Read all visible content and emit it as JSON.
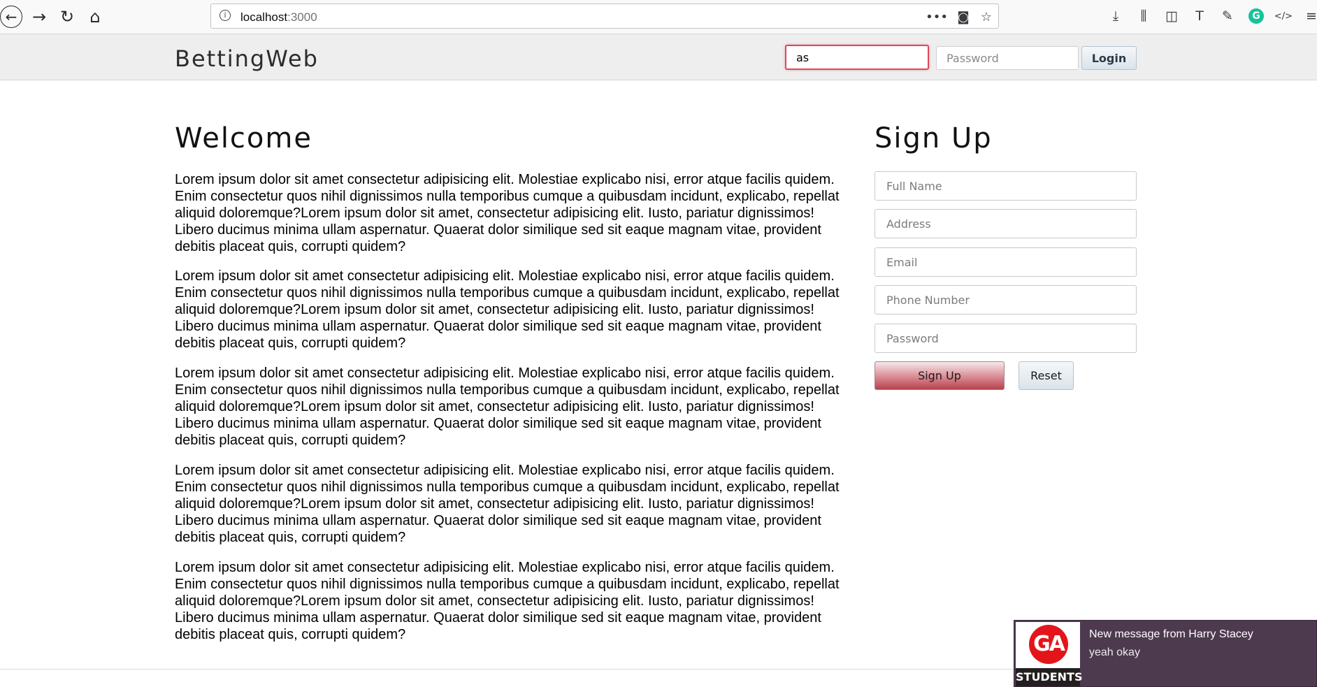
{
  "browser": {
    "url_host": "localhost",
    "url_port": ":3000"
  },
  "navbar": {
    "brand": "BettingWeb",
    "username_value": "as",
    "password_placeholder": "Password",
    "login_label": "Login"
  },
  "main": {
    "title": "Welcome",
    "paragraphs": [
      "Lorem ipsum dolor sit amet consectetur adipisicing elit. Molestiae explicabo nisi, error atque facilis quidem. Enim consectetur quos nihil dignissimos nulla temporibus cumque a quibusdam incidunt, explicabo, repellat aliquid doloremque?Lorem ipsum dolor sit amet, consectetur adipisicing elit. Iusto, pariatur dignissimos! Libero ducimus minima ullam aspernatur. Quaerat dolor similique sed sit eaque magnam vitae, provident debitis placeat quis, corrupti quidem?",
      "Lorem ipsum dolor sit amet consectetur adipisicing elit. Molestiae explicabo nisi, error atque facilis quidem. Enim consectetur quos nihil dignissimos nulla temporibus cumque a quibusdam incidunt, explicabo, repellat aliquid doloremque?Lorem ipsum dolor sit amet, consectetur adipisicing elit. Iusto, pariatur dignissimos! Libero ducimus minima ullam aspernatur. Quaerat dolor similique sed sit eaque magnam vitae, provident debitis placeat quis, corrupti quidem?",
      "Lorem ipsum dolor sit amet consectetur adipisicing elit. Molestiae explicabo nisi, error atque facilis quidem. Enim consectetur quos nihil dignissimos nulla temporibus cumque a quibusdam incidunt, explicabo, repellat aliquid doloremque?Lorem ipsum dolor sit amet, consectetur adipisicing elit. Iusto, pariatur dignissimos! Libero ducimus minima ullam aspernatur. Quaerat dolor similique sed sit eaque magnam vitae, provident debitis placeat quis, corrupti quidem?",
      "Lorem ipsum dolor sit amet consectetur adipisicing elit. Molestiae explicabo nisi, error atque facilis quidem. Enim consectetur quos nihil dignissimos nulla temporibus cumque a quibusdam incidunt, explicabo, repellat aliquid doloremque?Lorem ipsum dolor sit amet, consectetur adipisicing elit. Iusto, pariatur dignissimos! Libero ducimus minima ullam aspernatur. Quaerat dolor similique sed sit eaque magnam vitae, provident debitis placeat quis, corrupti quidem?",
      "Lorem ipsum dolor sit amet consectetur adipisicing elit. Molestiae explicabo nisi, error atque facilis quidem. Enim consectetur quos nihil dignissimos nulla temporibus cumque a quibusdam incidunt, explicabo, repellat aliquid doloremque?Lorem ipsum dolor sit amet, consectetur adipisicing elit. Iusto, pariatur dignissimos! Libero ducimus minima ullam aspernatur. Quaerat dolor similique sed sit eaque magnam vitae, provident debitis placeat quis, corrupti quidem?"
    ]
  },
  "signup": {
    "title": "Sign Up",
    "full_name_placeholder": "Full Name",
    "address_placeholder": "Address",
    "email_placeholder": "Email",
    "phone_placeholder": "Phone Number",
    "password_placeholder": "Password",
    "signup_label": "Sign Up",
    "reset_label": "Reset"
  },
  "notification": {
    "logo_text": "GA",
    "logo_subtext": "STUDENTS",
    "title": "New message from Harry Stacey",
    "body": "yeah okay"
  },
  "colors": {
    "navbar_bg": "#eeeeee",
    "signup_button": "#b7424e",
    "notification_bg": "#4e3a4f",
    "focus_border": "#e0475a"
  }
}
